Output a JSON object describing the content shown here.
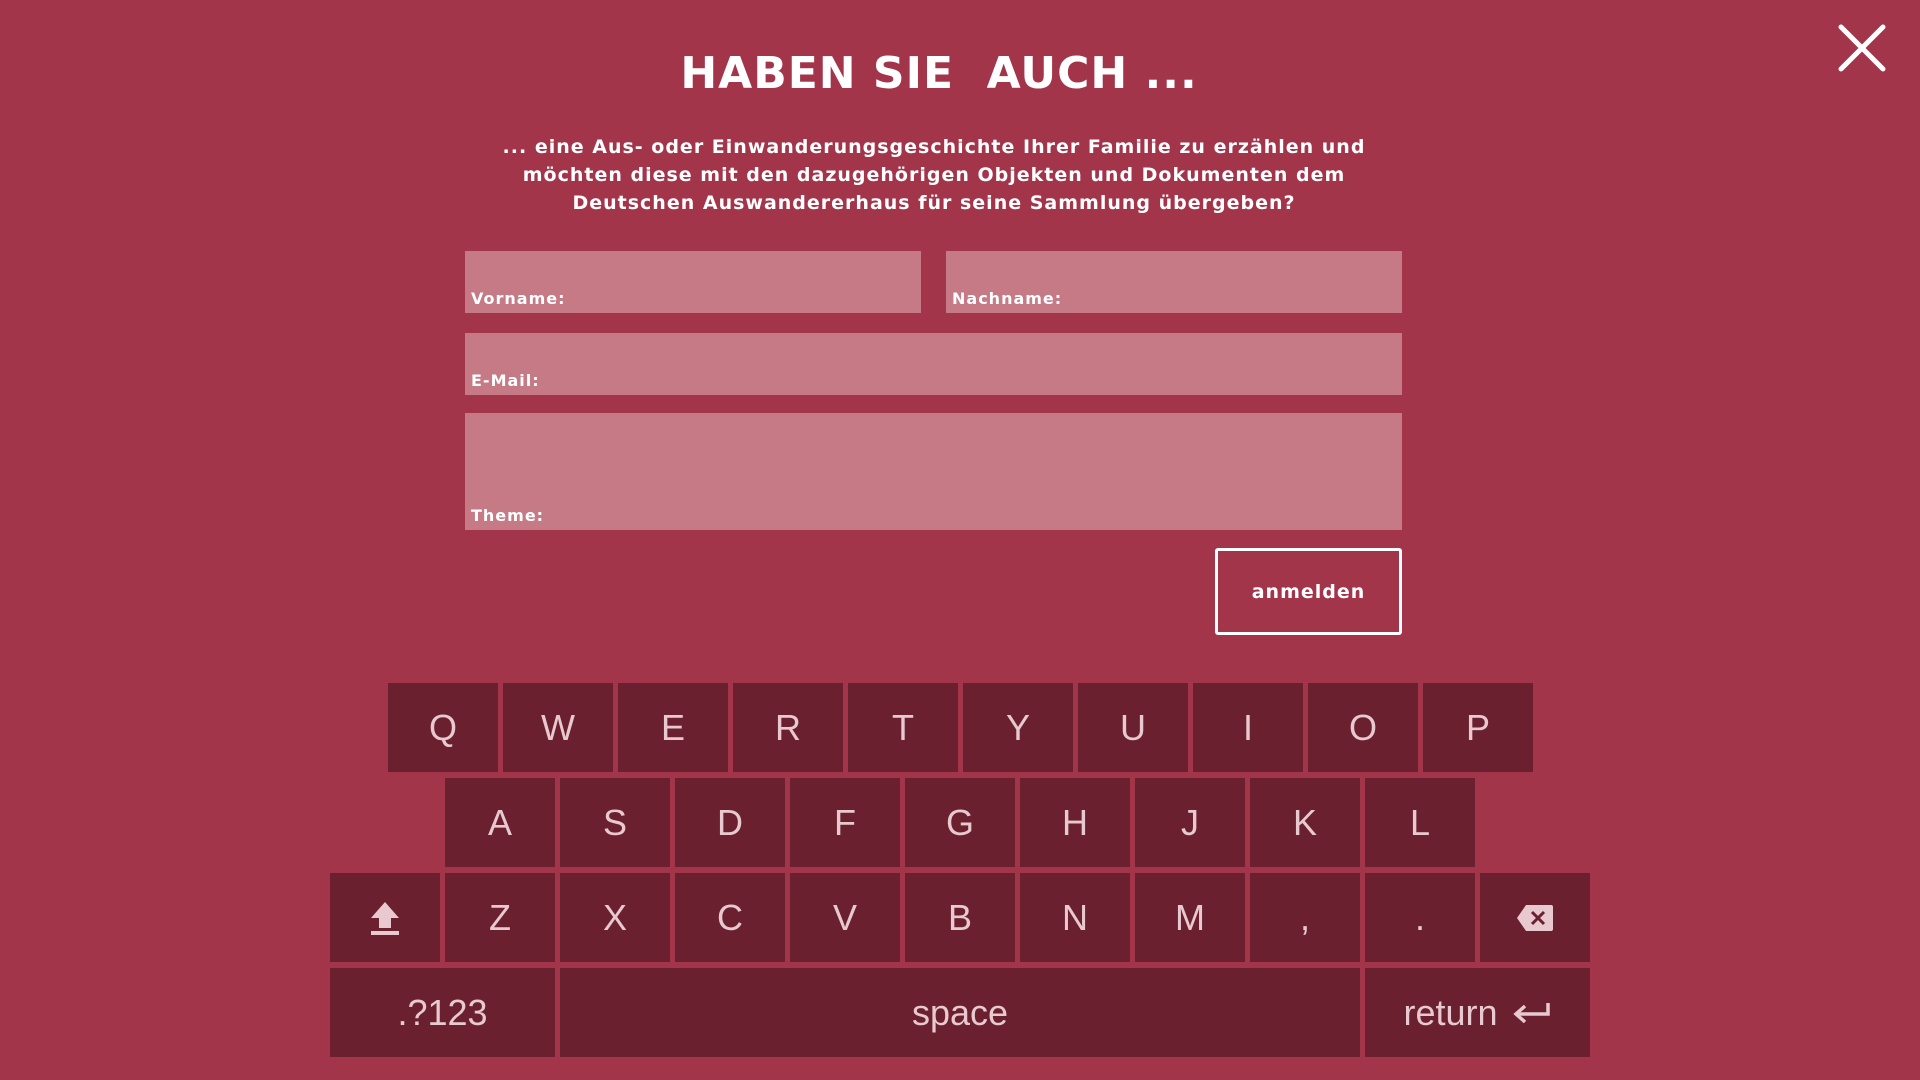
{
  "header": {
    "title": "HABEN SIE  AUCH ...",
    "intro_lines": [
      "... eine Aus- oder Einwanderungsgeschichte Ihrer Familie zu erzählen und",
      "möchten diese mit den dazugehörigen Objekten und Dokumenten dem",
      "Deutschen Auswandererhaus für seine Sammlung übergeben?"
    ]
  },
  "form": {
    "first_name_label": "Vorname:",
    "last_name_label": "Nachname:",
    "email_label": "E-Mail:",
    "topic_label": "Theme:",
    "submit_label": "anmelden"
  },
  "keyboard": {
    "row1": [
      "Q",
      "W",
      "E",
      "R",
      "T",
      "Y",
      "U",
      "I",
      "O",
      "P"
    ],
    "row2": [
      "A",
      "S",
      "D",
      "F",
      "G",
      "H",
      "J",
      "K",
      "L"
    ],
    "row3": [
      "Z",
      "X",
      "C",
      "V",
      "B",
      "N",
      "M",
      ",",
      "."
    ],
    "symbols_label": ".?123",
    "space_label": "space",
    "return_label": "return"
  },
  "icons": {
    "close": "close-icon",
    "shift": "shift-arrow-icon",
    "backspace": "backspace-icon",
    "return": "return-arrow-icon"
  },
  "colors": {
    "background": "#a3354a",
    "field": "#c57a86",
    "key": "#6a202e",
    "key_text": "#e8c9cf",
    "text": "#ffffff"
  }
}
